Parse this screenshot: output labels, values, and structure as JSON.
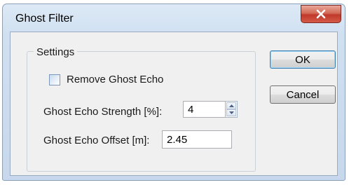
{
  "window": {
    "title": "Ghost Filter"
  },
  "settings": {
    "group_label": "Settings",
    "remove_ghost_echo": {
      "label": "Remove Ghost Echo",
      "checked": false
    },
    "strength": {
      "label": "Ghost Echo Strength [%]:",
      "value": "4"
    },
    "offset": {
      "label": "Ghost Echo Offset [m]:",
      "value": "2.45"
    }
  },
  "buttons": {
    "ok": "OK",
    "cancel": "Cancel"
  },
  "icons": {
    "close": "close-icon",
    "spin_up": "arrow-up-icon",
    "spin_down": "arrow-down-icon"
  },
  "colors": {
    "close_button": "#c0392b",
    "window_frame": "#cfe0f1",
    "dialog_bg": "#f0f0f0"
  }
}
